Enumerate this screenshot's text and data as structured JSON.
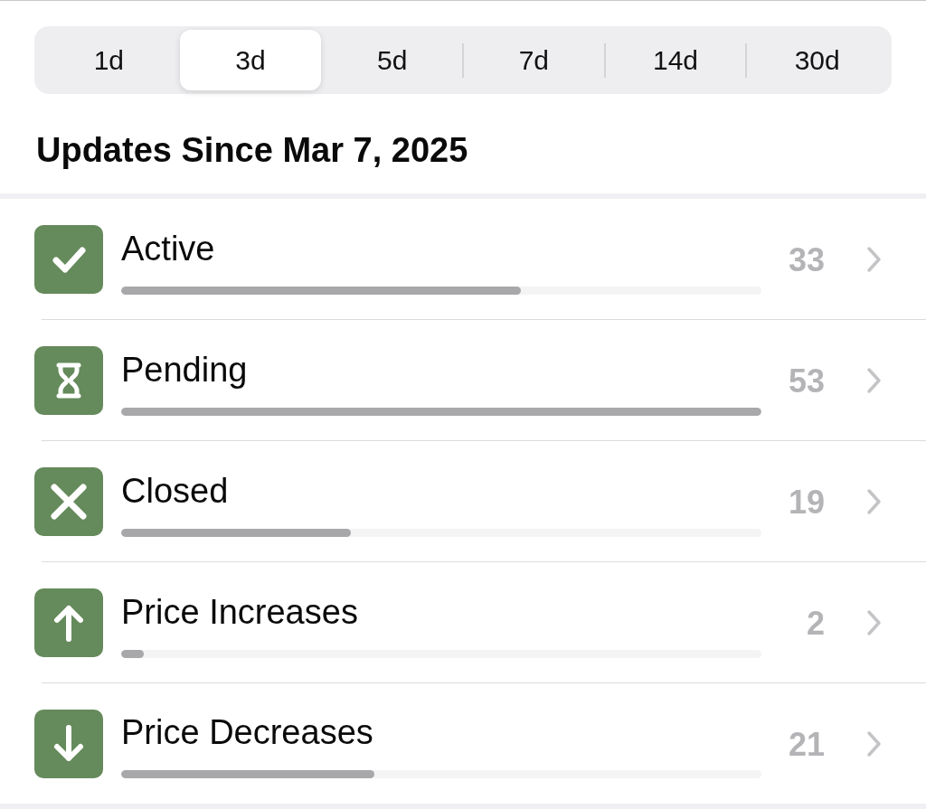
{
  "segments": [
    {
      "label": "1d",
      "selected": false
    },
    {
      "label": "3d",
      "selected": true
    },
    {
      "label": "5d",
      "selected": false
    },
    {
      "label": "7d",
      "selected": false
    },
    {
      "label": "14d",
      "selected": false
    },
    {
      "label": "30d",
      "selected": false
    }
  ],
  "heading": "Updates Since Mar 7, 2025",
  "rows": [
    {
      "kind": "active",
      "label": "Active",
      "count": "33",
      "level": 0.624
    },
    {
      "kind": "pending",
      "label": "Pending",
      "count": "53",
      "level": 1
    },
    {
      "kind": "closed",
      "label": "Closed",
      "count": "19",
      "level": 0.359
    },
    {
      "kind": "increase",
      "label": "Price Increases",
      "count": "2",
      "level": 0.036
    },
    {
      "kind": "decrease",
      "label": "Price Decreases",
      "count": "21",
      "level": 0.396
    }
  ]
}
